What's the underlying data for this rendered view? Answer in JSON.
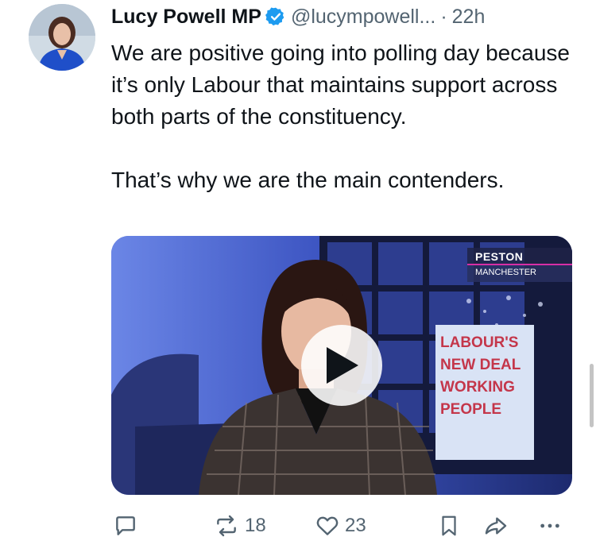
{
  "tweet": {
    "author_name": "Lucy Powell MP",
    "handle": "@lucympowell...",
    "separator": "·",
    "time": "22h",
    "text": "We are positive going into polling day because it’s only Labour that maintains support across both parts of the constituency.\n\nThat’s why we are the main contenders.",
    "verified_color": "#1d9bf0"
  },
  "media": {
    "overlay_brand": "PESTON",
    "overlay_location": "MANCHESTER",
    "poster_text": "LABOUR'S NEW DEAL WORKING PEOPLE",
    "accent_color": "#d62ea6"
  },
  "actions": {
    "reply_icon": "reply-bubble-icon",
    "repost_count": "18",
    "like_count": "23",
    "bookmark_icon": "bookmark-icon",
    "share_icon": "share-arrow-icon",
    "more_icon": "more-dots-icon"
  }
}
